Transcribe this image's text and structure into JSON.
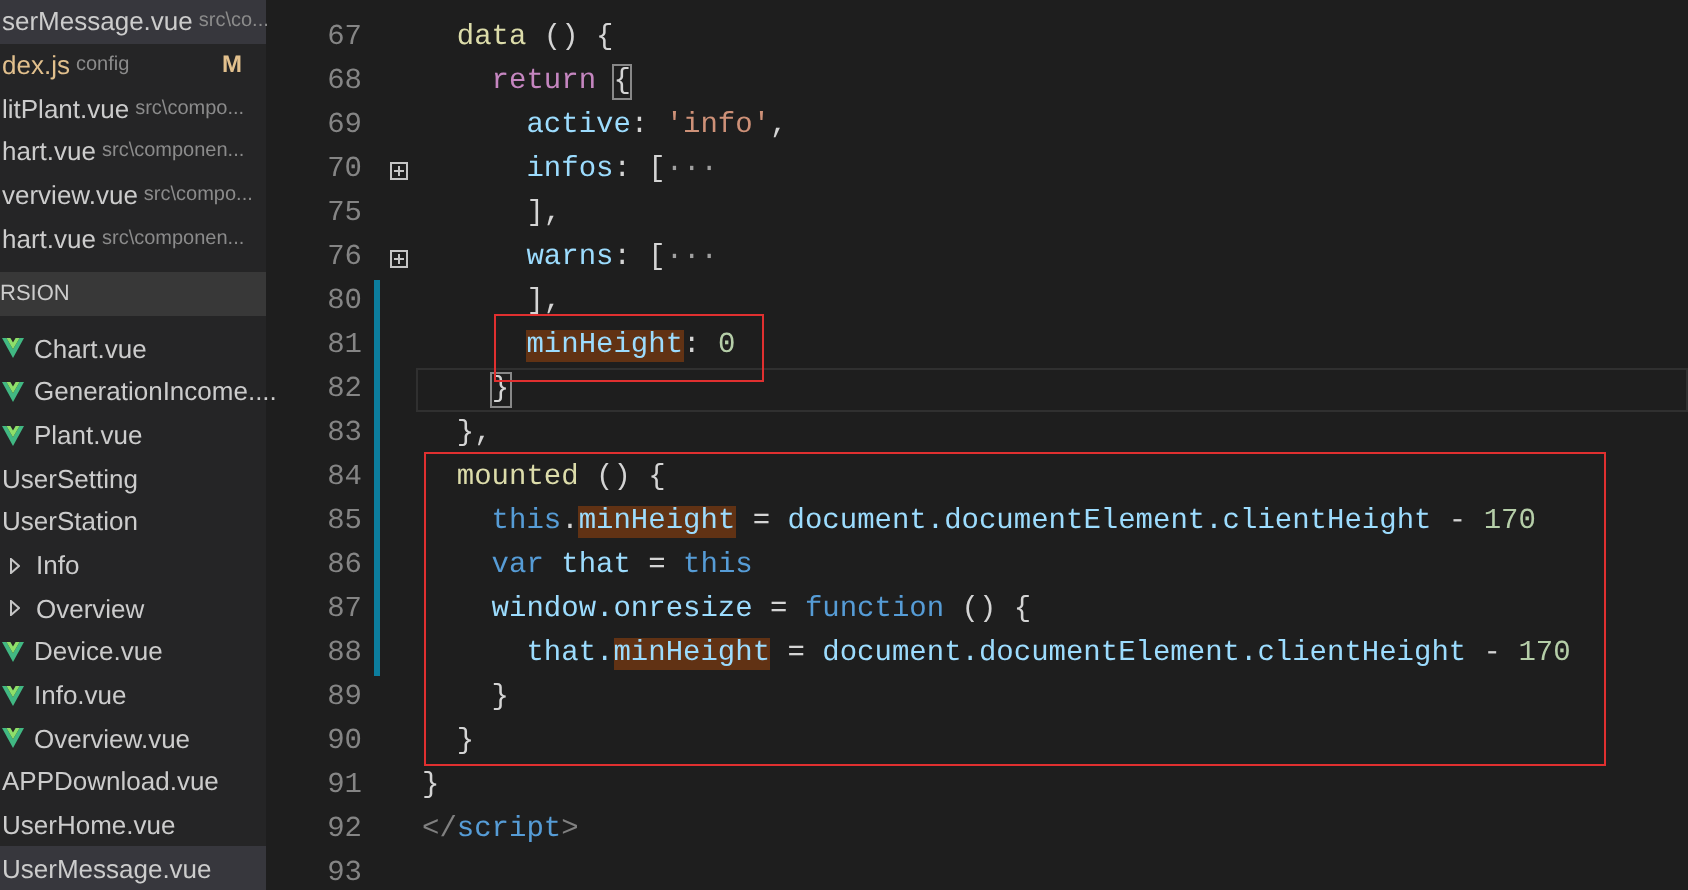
{
  "sidebar": {
    "open_editors": [
      {
        "name": "serMessage.vue",
        "description": "src\\co...",
        "modified": false,
        "selected": true
      },
      {
        "name": "dex.js",
        "description": "config",
        "badge": "M",
        "modified": true,
        "selected": false
      },
      {
        "name": "litPlant.vue",
        "description": "src\\compo...",
        "modified": false,
        "selected": false
      },
      {
        "name": "hart.vue",
        "description": "src\\componen...",
        "modified": false,
        "selected": false
      },
      {
        "name": "verview.vue",
        "description": "src\\compo...",
        "modified": false,
        "selected": false
      },
      {
        "name": "hart.vue",
        "description": "src\\componen...",
        "modified": false,
        "selected": false
      }
    ],
    "section_header": "RSION",
    "tree": [
      {
        "kind": "vue",
        "name": "Chart.vue",
        "selected": false
      },
      {
        "kind": "vue",
        "name": "GenerationIncome....",
        "selected": false
      },
      {
        "kind": "vue",
        "name": "Plant.vue",
        "selected": false
      },
      {
        "kind": "folder",
        "name": "UserSetting",
        "selected": false
      },
      {
        "kind": "folder",
        "name": "UserStation",
        "selected": false
      },
      {
        "kind": "collapsed",
        "name": "Info",
        "selected": false
      },
      {
        "kind": "collapsed",
        "name": "Overview",
        "selected": false
      },
      {
        "kind": "vue",
        "name": "Device.vue",
        "selected": false
      },
      {
        "kind": "vue",
        "name": "Info.vue",
        "selected": false
      },
      {
        "kind": "vue",
        "name": "Overview.vue",
        "selected": false
      },
      {
        "kind": "file",
        "name": "APPDownload.vue",
        "selected": false
      },
      {
        "kind": "file",
        "name": "UserHome.vue",
        "selected": false
      },
      {
        "kind": "file",
        "name": "UserMessage.vue",
        "selected": true
      }
    ]
  },
  "editor": {
    "lines": [
      {
        "number": "67",
        "fold": false,
        "modified": false,
        "current": false,
        "tokens": [
          {
            "kind": "fn",
            "text": "  data"
          },
          {
            "kind": "p",
            "text": " () {"
          }
        ]
      },
      {
        "number": "68",
        "fold": false,
        "modified": false,
        "current": false,
        "tokens": [
          {
            "kind": "ctl",
            "text": "    return "
          },
          {
            "kind": "br",
            "text": "{"
          }
        ]
      },
      {
        "number": "69",
        "fold": false,
        "modified": false,
        "current": false,
        "tokens": [
          {
            "kind": "prop",
            "text": "      active"
          },
          {
            "kind": "p",
            "text": ": "
          },
          {
            "kind": "str",
            "text": "'info'"
          },
          {
            "kind": "p",
            "text": ","
          }
        ]
      },
      {
        "number": "70",
        "fold": true,
        "modified": false,
        "current": false,
        "tokens": [
          {
            "kind": "prop",
            "text": "      infos"
          },
          {
            "kind": "p",
            "text": ": ["
          },
          {
            "kind": "dim",
            "text": "···"
          }
        ]
      },
      {
        "number": "75",
        "fold": false,
        "modified": false,
        "current": false,
        "tokens": [
          {
            "kind": "p",
            "text": "      ],"
          }
        ]
      },
      {
        "number": "76",
        "fold": true,
        "modified": false,
        "current": false,
        "tokens": [
          {
            "kind": "prop",
            "text": "      warns"
          },
          {
            "kind": "p",
            "text": ": ["
          },
          {
            "kind": "dim",
            "text": "···"
          }
        ]
      },
      {
        "number": "80",
        "fold": false,
        "modified": true,
        "current": false,
        "tokens": [
          {
            "kind": "p",
            "text": "      ],"
          }
        ]
      },
      {
        "number": "81",
        "fold": false,
        "modified": true,
        "current": false,
        "tokens": [
          {
            "kind": "hl",
            "text": "      minHeight"
          },
          {
            "kind": "p",
            "text": ": "
          },
          {
            "kind": "num",
            "text": "0"
          }
        ]
      },
      {
        "number": "82",
        "fold": false,
        "modified": true,
        "current": true,
        "tokens": [
          {
            "kind": "br",
            "text": "    }"
          }
        ]
      },
      {
        "number": "83",
        "fold": false,
        "modified": true,
        "current": false,
        "tokens": [
          {
            "kind": "p",
            "text": "  },"
          }
        ]
      },
      {
        "number": "84",
        "fold": false,
        "modified": true,
        "current": false,
        "tokens": [
          {
            "kind": "fn",
            "text": "  mounted"
          },
          {
            "kind": "p",
            "text": " () {"
          }
        ]
      },
      {
        "number": "85",
        "fold": false,
        "modified": true,
        "current": false,
        "tokens": [
          {
            "kind": "kw",
            "text": "    this"
          },
          {
            "kind": "p",
            "text": "."
          },
          {
            "kind": "hl",
            "text": "minHeight"
          },
          {
            "kind": "p",
            "text": " = "
          },
          {
            "kind": "prop",
            "text": "document.documentElement.clientHeight"
          },
          {
            "kind": "p",
            "text": " - "
          },
          {
            "kind": "num",
            "text": "170"
          }
        ]
      },
      {
        "number": "86",
        "fold": false,
        "modified": true,
        "current": false,
        "tokens": [
          {
            "kind": "kw",
            "text": "    var"
          },
          {
            "kind": "prop",
            "text": " that"
          },
          {
            "kind": "p",
            "text": " = "
          },
          {
            "kind": "kw",
            "text": "this"
          }
        ]
      },
      {
        "number": "87",
        "fold": false,
        "modified": true,
        "current": false,
        "tokens": [
          {
            "kind": "prop",
            "text": "    window.onresize"
          },
          {
            "kind": "p",
            "text": " = "
          },
          {
            "kind": "kw",
            "text": "function"
          },
          {
            "kind": "p",
            "text": " () {"
          }
        ]
      },
      {
        "number": "88",
        "fold": false,
        "modified": true,
        "current": false,
        "tokens": [
          {
            "kind": "prop",
            "text": "      that."
          },
          {
            "kind": "hl",
            "text": "minHeight"
          },
          {
            "kind": "p",
            "text": " = "
          },
          {
            "kind": "prop",
            "text": "document.documentElement.clientHeight"
          },
          {
            "kind": "p",
            "text": " - "
          },
          {
            "kind": "num",
            "text": "170"
          }
        ]
      },
      {
        "number": "89",
        "fold": false,
        "modified": false,
        "current": false,
        "tokens": [
          {
            "kind": "p",
            "text": "    }"
          }
        ]
      },
      {
        "number": "90",
        "fold": false,
        "modified": false,
        "current": false,
        "tokens": [
          {
            "kind": "p",
            "text": "  }"
          }
        ]
      },
      {
        "number": "91",
        "fold": false,
        "modified": false,
        "current": false,
        "tokens": [
          {
            "kind": "p",
            "text": "}"
          }
        ]
      },
      {
        "number": "92",
        "fold": false,
        "modified": false,
        "current": false,
        "tokens": [
          {
            "kind": "tagp",
            "text": "</"
          },
          {
            "kind": "tag",
            "text": "script"
          },
          {
            "kind": "tagp",
            "text": ">"
          }
        ]
      },
      {
        "number": "93",
        "fold": false,
        "modified": false,
        "current": false
      }
    ]
  }
}
